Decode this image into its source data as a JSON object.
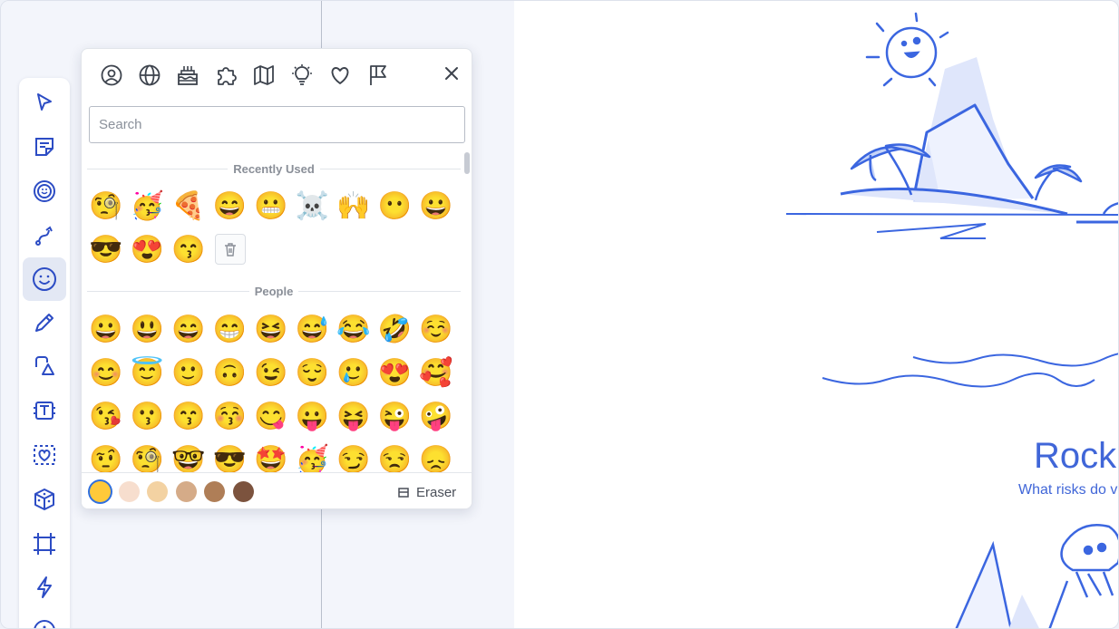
{
  "canvas": {
    "title": "Rock",
    "subtitle": "What risks do v"
  },
  "toolbar": {
    "tools": [
      "select",
      "sticky-note",
      "sticker",
      "connector",
      "emoji",
      "pen",
      "shapes",
      "text",
      "frame-heart",
      "dice",
      "frame",
      "lightning",
      "more"
    ]
  },
  "picker": {
    "categories": [
      "people",
      "nature",
      "food",
      "activity",
      "travel",
      "objects",
      "symbols",
      "flags"
    ],
    "search_placeholder": "Search",
    "recently_used_label": "Recently Used",
    "people_label": "People",
    "eraser_label": "Eraser",
    "skin_tones": [
      "#ffc93a",
      "#f7dece",
      "#f3d2a2",
      "#d5ab88",
      "#af7e57",
      "#7c533e"
    ],
    "recent": [
      "🧐",
      "🥳",
      "🍕",
      "😄",
      "😬",
      "☠️",
      "🙌",
      "😶",
      "😀",
      "😎",
      "😍",
      "😙"
    ],
    "people": [
      "😀",
      "😃",
      "😄",
      "😁",
      "😆",
      "😅",
      "😂",
      "🤣",
      "☺️",
      "😊",
      "😇",
      "🙂",
      "🙃",
      "😉",
      "😌",
      "🥲",
      "😍",
      "🥰",
      "😘",
      "😗",
      "😙",
      "😚",
      "😋",
      "😛",
      "😝",
      "😜",
      "🤪",
      "🤨",
      "🧐",
      "🤓",
      "😎",
      "🤩",
      "🥳",
      "😏",
      "😒",
      "😞"
    ]
  }
}
